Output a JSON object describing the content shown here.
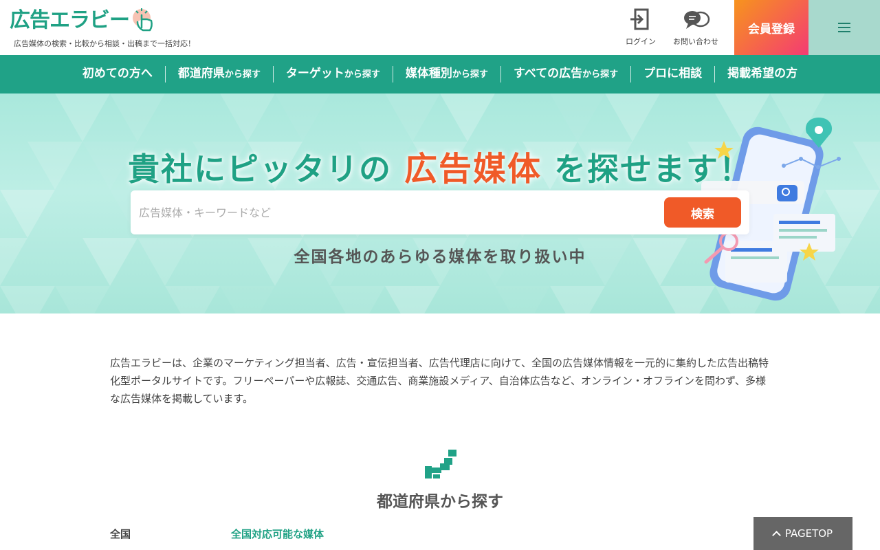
{
  "header": {
    "logo_text": "広告エラビー",
    "tagline": "広告媒体の検索・比較から相談・出稿まで一括対応！",
    "login_label": "ログイン",
    "contact_label": "お問い合わせ",
    "register_label": "会員登録"
  },
  "nav": {
    "items": [
      {
        "main": "初めての方へ",
        "suffix": ""
      },
      {
        "main": "都道府県",
        "suffix": "から探す"
      },
      {
        "main": "ターゲット",
        "suffix": "から探す"
      },
      {
        "main": "媒体種別",
        "suffix": "から探す"
      },
      {
        "main": "すべての広告",
        "suffix": "から探す"
      },
      {
        "main": "プロに相談",
        "suffix": ""
      },
      {
        "main": "掲載希望の方",
        "suffix": ""
      }
    ]
  },
  "hero": {
    "title_pre": "貴社にピッタリの",
    "title_highlight": "広告媒体",
    "title_post": "を探せます！",
    "search_placeholder": "広告媒体・キーワードなど",
    "search_button": "検索",
    "subtitle": "全国各地のあらゆる媒体を取り扱い中"
  },
  "intro": {
    "text": "広告エラビーは、企業のマーケティング担当者、広告・宣伝担当者、広告代理店に向けて、全国の広告媒体情報を一元的に集約した広告出稿特化型ポータルサイトです。フリーペーパーや広報誌、交通広告、商業施設メディア、自治体広告など、オンライン・オフラインを問わず、多様な広告媒体を掲載しています。"
  },
  "prefecture_section": {
    "title": "都道府県から探す",
    "region_label": "全国",
    "region_link": "全国対応可能な媒体"
  },
  "pagetop_label": "PAGETOP",
  "colors": {
    "brand_green": "#20a287",
    "accent_orange": "#f05a28",
    "register_gradient_start": "#f7941d",
    "register_gradient_end": "#f43b73"
  }
}
